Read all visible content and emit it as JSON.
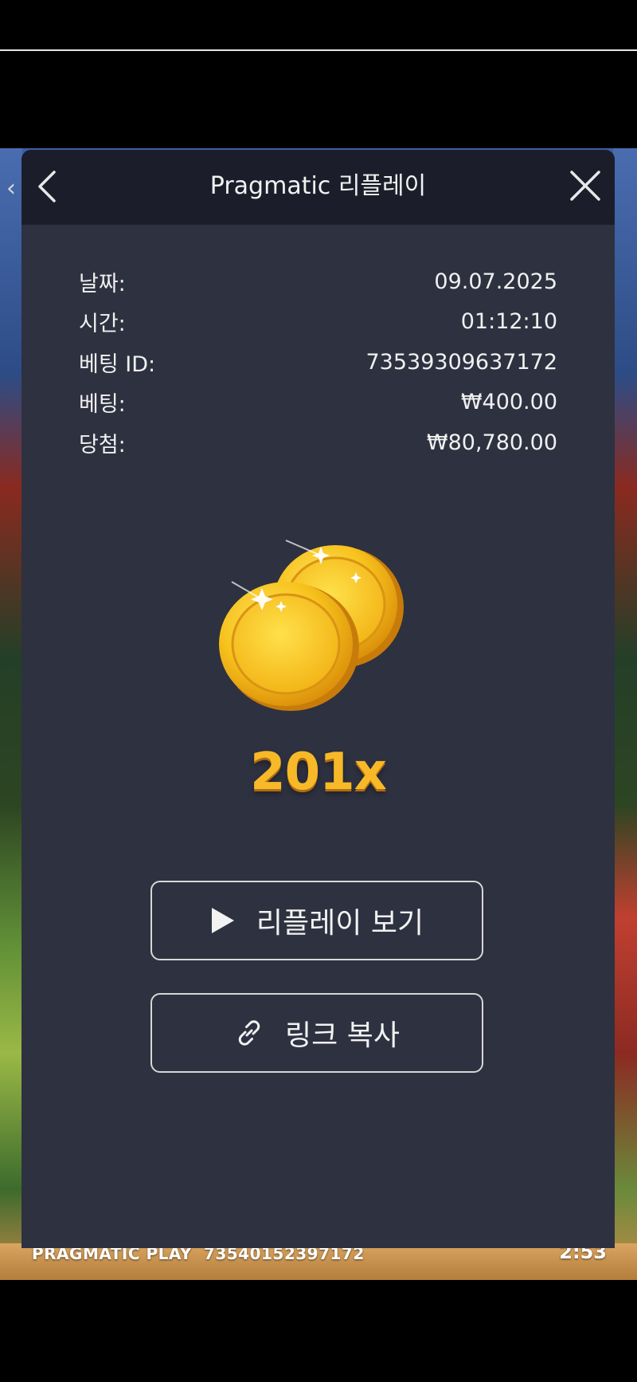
{
  "modal": {
    "title": "Pragmatic 리플레이"
  },
  "details": [
    {
      "label": "날짜:",
      "value": "09.07.2025"
    },
    {
      "label": "시간:",
      "value": "01:12:10"
    },
    {
      "label": "베팅 ID:",
      "value": "73539309637172"
    },
    {
      "label": "베팅:",
      "value": "₩400.00"
    },
    {
      "label": "당첨:",
      "value": "₩80,780.00"
    }
  ],
  "result": {
    "multiplier": "201x"
  },
  "actions": {
    "watch_replay": "리플레이 보기",
    "copy_link": "링크 복사"
  },
  "game_footer": {
    "brand": "PRAGMATIC PLAY",
    "round_id": "73540152397172",
    "time": "2:53"
  },
  "icons": {
    "back": "chevron-left-icon",
    "close": "close-icon",
    "play": "play-icon",
    "link": "link-icon"
  },
  "colors": {
    "modal_bg": "#2e3140",
    "header_bg": "#1b1e2a",
    "multiplier": "#f7b928"
  }
}
